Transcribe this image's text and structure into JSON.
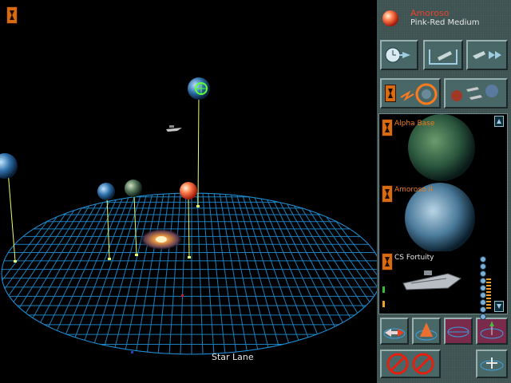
{
  "selected": {
    "name": "Amoroso",
    "type": "Pink-Red Medium",
    "color": "#e7432a"
  },
  "viewport": {
    "bottom_label": "Star Lane"
  },
  "list_items": [
    {
      "label": "Alpha Base",
      "label_color": "#f07a1a",
      "kind": "planet"
    },
    {
      "label": "Amoroso II",
      "label_color": "#f07a1a",
      "kind": "planet"
    },
    {
      "label": "CS Fortuity",
      "label_color": "#e8e8e8",
      "kind": "ship"
    }
  ],
  "controls": {
    "top_row": [
      "clock-arrow-icon",
      "ship-launch-icon",
      "fleet-fast-icon"
    ],
    "mid_row": [
      "orbit-target-icon",
      "fleet-planets-icon"
    ],
    "bottom_row1": [
      "arrows-grid-icon",
      "cone-grid-icon",
      "grid-magenta-icon",
      "axis-grid-icon"
    ],
    "bottom_row2": [
      "no-move-icon",
      "no-ship-icon",
      "add-grid-icon"
    ]
  }
}
